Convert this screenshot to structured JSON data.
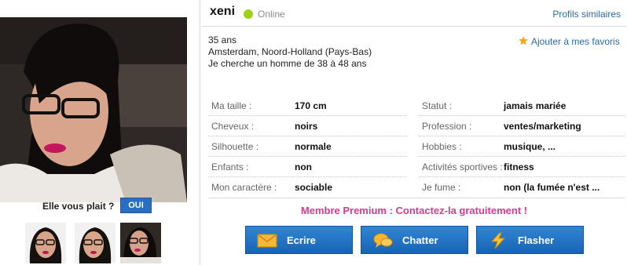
{
  "profile": {
    "username": "xeni",
    "status": "Online",
    "similar_profiles": "Profils similaires",
    "age": "35 ans",
    "location": "Amsterdam, Noord-Holland (Pays-Bas)",
    "seeking": "Je cherche un homme de 38 à 48 ans",
    "add_favorite": "Ajouter à mes favoris",
    "status_color": "#9ed21a"
  },
  "like": {
    "question": "Elle vous plait ?",
    "yes_label": "OUI"
  },
  "attributes_left": [
    {
      "label": "Ma taille :",
      "value": "170 cm"
    },
    {
      "label": "Cheveux :",
      "value": "noirs"
    },
    {
      "label": "Silhouette :",
      "value": "normale"
    },
    {
      "label": "Enfants :",
      "value": "non"
    },
    {
      "label": "Mon caractère :",
      "value": "sociable"
    }
  ],
  "attributes_right": [
    {
      "label": "Statut :",
      "value": "jamais mariée"
    },
    {
      "label": "Profession :",
      "value": "ventes/marketing"
    },
    {
      "label": "Hobbies :",
      "value": "musique, ..."
    },
    {
      "label": "Activités sportives :",
      "value": "fitness"
    },
    {
      "label": "Je fume :",
      "value": "non (la fumée n'est ..."
    }
  ],
  "premium_text": "Membre Premium : Contactez-la gratuitement !",
  "actions": [
    {
      "label": "Ecrire",
      "icon": "envelope-icon"
    },
    {
      "label": "Chatter",
      "icon": "chat-bubbles-icon"
    },
    {
      "label": "Flasher",
      "icon": "lightning-icon"
    }
  ],
  "colors": {
    "accent_blue": "#2a6fbf",
    "premium_pink": "#d83b8c",
    "link_blue": "#2b6aa8",
    "star": "#f5a623"
  }
}
